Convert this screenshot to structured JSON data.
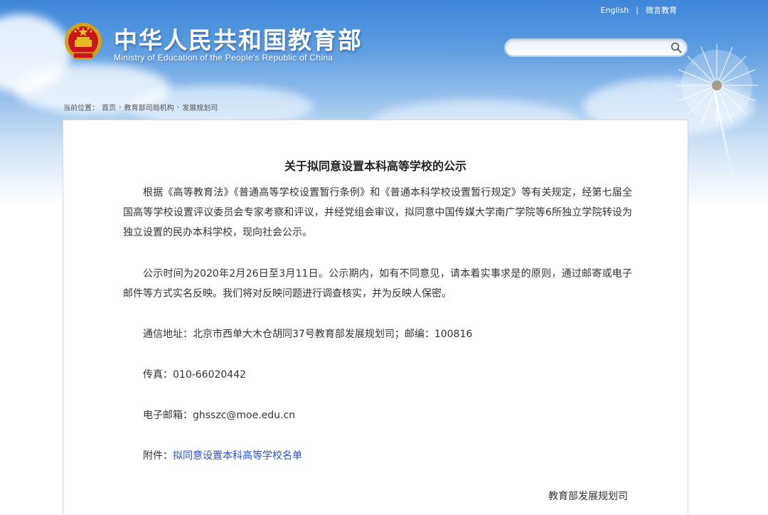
{
  "header": {
    "title_cn": "中华人民共和国教育部",
    "title_en": "Ministry of Education of the People's Republic of China",
    "top_links": {
      "english": "English",
      "separator": "|",
      "weibo": "微言教育"
    },
    "search": {
      "placeholder": ""
    }
  },
  "breadcrumb": {
    "prefix": "当前位置：",
    "items": [
      "首页",
      "教育部司局机构",
      "发展规划司"
    ],
    "chevron": "›"
  },
  "article": {
    "title": "关于拟同意设置本科高等学校的公示",
    "paragraph_1": "根据《高等教育法》《普通高等学校设置暂行条例》和《普通本科学校设置暂行规定》等有关规定，经第七届全国高等学校设置评议委员会专家考察和评议，并经党组会审议，拟同意中国传媒大学南广学院等6所独立学院转设为独立设置的民办本科学校，现向社会公示。",
    "paragraph_2": "公示时间为2020年2月26日至3月11日。公示期内，如有不同意见，请本着实事求是的原则，通过邮寄或电子邮件等方式实名反映。我们将对反映问题进行调查核实，并为反映人保密。",
    "address_label": "通信地址：",
    "address_value": "北京市西单大木仓胡同37号教育部发展规划司；邮编：100816",
    "fax_label": "传真：",
    "fax_value": "010-66020442",
    "email_label": "电子邮箱：",
    "email_value": "ghsszc@moe.edu.cn",
    "attachment_label": "附件：",
    "attachment_link": "拟同意设置本科高等学校名单",
    "signature": "教育部发展规划司"
  },
  "colors": {
    "link": "#2b4fc8",
    "sky_top": "#3f86d8",
    "text": "#333333"
  }
}
